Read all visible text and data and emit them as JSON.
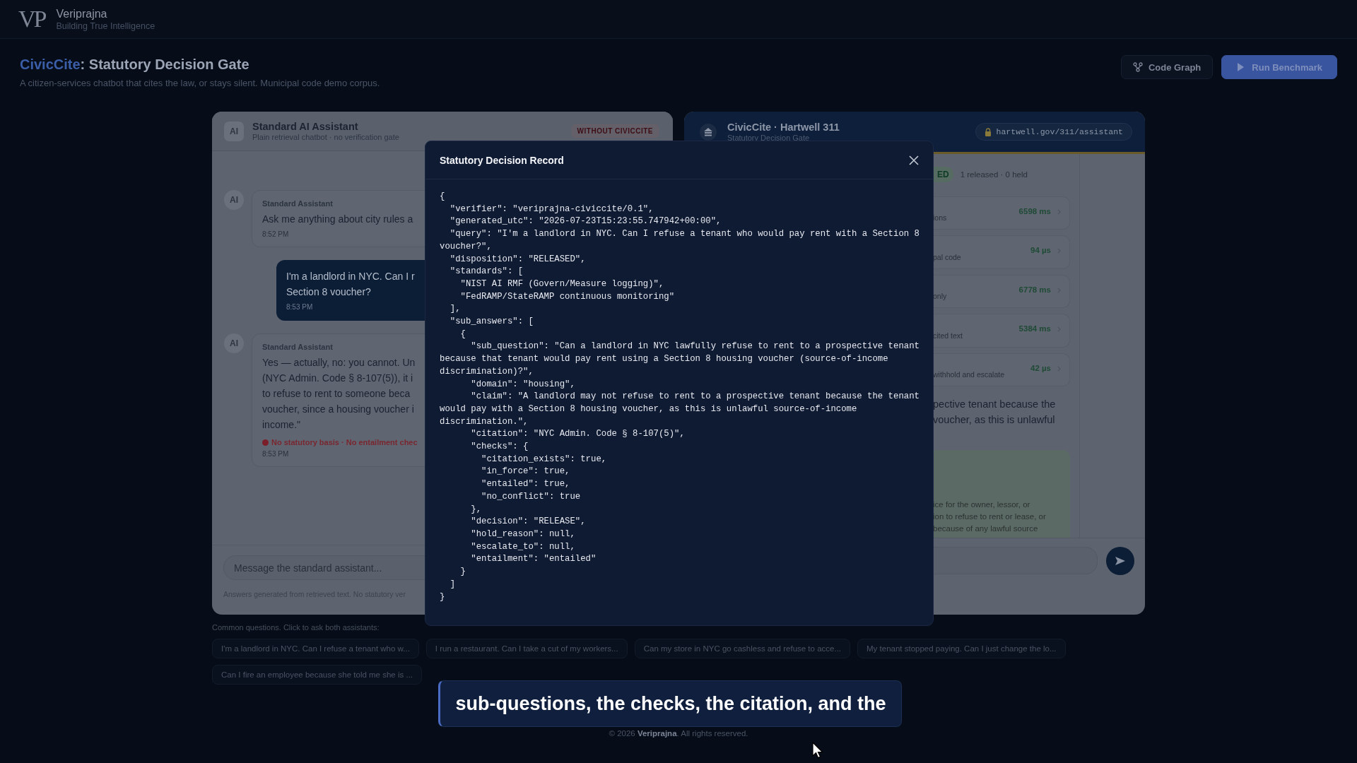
{
  "brand": {
    "logo": "VP",
    "name": "Veriprajna",
    "tagline": "Building True Intelligence"
  },
  "page": {
    "title_highlight": "CivicCite",
    "title_rest": ": Statutory Decision Gate",
    "subtitle": "A citizen-services chatbot that cites the law, or stays silent. Municipal code demo corpus."
  },
  "actions": [
    {
      "label": "Code Graph",
      "kind": "secondary"
    },
    {
      "label": "Run Benchmark",
      "kind": "primary"
    }
  ],
  "standard_panel": {
    "avatar": "AI",
    "title": "Standard AI Assistant",
    "subtitle": "Plain retrieval chatbot · no verification gate",
    "badge": "WITHOUT CIVICCITE",
    "messages": [
      {
        "kind": "assistant",
        "avatar": "AI",
        "sender": "Standard Assistant",
        "lines": [
          "Ask me anything about city rules a"
        ],
        "time": "8:52 PM"
      },
      {
        "kind": "user",
        "lines": [
          "I'm a landlord in NYC. Can I r",
          "Section 8 voucher?"
        ],
        "time": "8:53 PM"
      },
      {
        "kind": "assistant",
        "avatar": "AI",
        "sender": "Standard Assistant",
        "lines": [
          "Yes — actually, no: you cannot. Un",
          "(NYC Admin. Code § 8-107(5)), it i",
          "to refuse to rent to someone beca",
          "voucher, since a housing voucher i",
          "income.\""
        ],
        "warning": "No statutory basis · No entailment chec",
        "time": "8:53 PM"
      }
    ],
    "input": {
      "placeholder": "Message the standard assistant..."
    },
    "footnote": "Answers generated from retrieved text. No statutory ver"
  },
  "civiccite_panel": {
    "title": "CivicCite · Hartwell 311",
    "subtitle": "Statutory Decision Gate",
    "url": "hartwell.gov/311/assistant",
    "status": {
      "badge": "ED",
      "summary": "1 released · 0 held"
    },
    "steps": [
      {
        "label": "ions",
        "timing": "6598 ms"
      },
      {
        "label": "pal code",
        "timing": "94 µs"
      },
      {
        "label": "only",
        "timing": "6778 ms"
      },
      {
        "label": "cited text",
        "timing": "5384 ms"
      },
      {
        "label": "withhold and escalate",
        "timing": "42 µs"
      }
    ],
    "answer_lines": [
      "pective tenant because the",
      "voucher, as this is unlawful"
    ],
    "citation_lines": [
      "ice for the owner, lessor, or",
      "ion to refuse to rent or lease, or",
      "because of any lawful source"
    ]
  },
  "common_questions": {
    "label": "Common questions. Click to ask both assistants:",
    "chips": [
      "I'm a landlord in NYC. Can I refuse a tenant who w...",
      "I run a restaurant. Can I take a cut of my workers...",
      "Can my store in NYC go cashless and refuse to acce...",
      "My tenant stopped paying. Can I just change the lo...",
      "Can I fire an employee because she told me she is ..."
    ]
  },
  "footer": "© 2026 **Veriprajna**. All rights reserved.",
  "modal": {
    "title": "Statutory Decision Record",
    "record_lines": [
      "{",
      "  \"verifier\": \"veriprajna-civiccite/0.1\",",
      "  \"generated_utc\": \"2026-07-23T15:23:55.747942+00:00\",",
      "  \"query\": \"I'm a landlord in NYC. Can I refuse a tenant who would pay rent with a Section 8",
      "voucher?\",",
      "  \"disposition\": \"RELEASED\",",
      "  \"standards\": [",
      "    \"NIST AI RMF (Govern/Measure logging)\",",
      "    \"FedRAMP/StateRAMP continuous monitoring\"",
      "  ],",
      "  \"sub_answers\": [",
      "    {",
      "      \"sub_question\": \"Can a landlord in NYC lawfully refuse to rent to a prospective tenant",
      "because that tenant would pay rent using a Section 8 housing voucher (source-of-income",
      "discrimination)?\",",
      "      \"domain\": \"housing\",",
      "      \"claim\": \"A landlord may not refuse to rent to a prospective tenant because the tenant",
      "would pay with a Section 8 housing voucher, as this is unlawful source-of-income",
      "discrimination.\",",
      "      \"citation\": \"NYC Admin. Code § 8-107(5)\",",
      "      \"checks\": {",
      "        \"citation_exists\": true,",
      "        \"in_force\": true,",
      "        \"entailed\": true,",
      "        \"no_conflict\": true",
      "      },",
      "      \"decision\": \"RELEASE\",",
      "      \"hold_reason\": null,",
      "      \"escalate_to\": null,",
      "      \"entailment\": \"entailed\"",
      "    }",
      "  ]",
      "}"
    ]
  },
  "caption": "sub-questions, the checks, the citation, and the"
}
